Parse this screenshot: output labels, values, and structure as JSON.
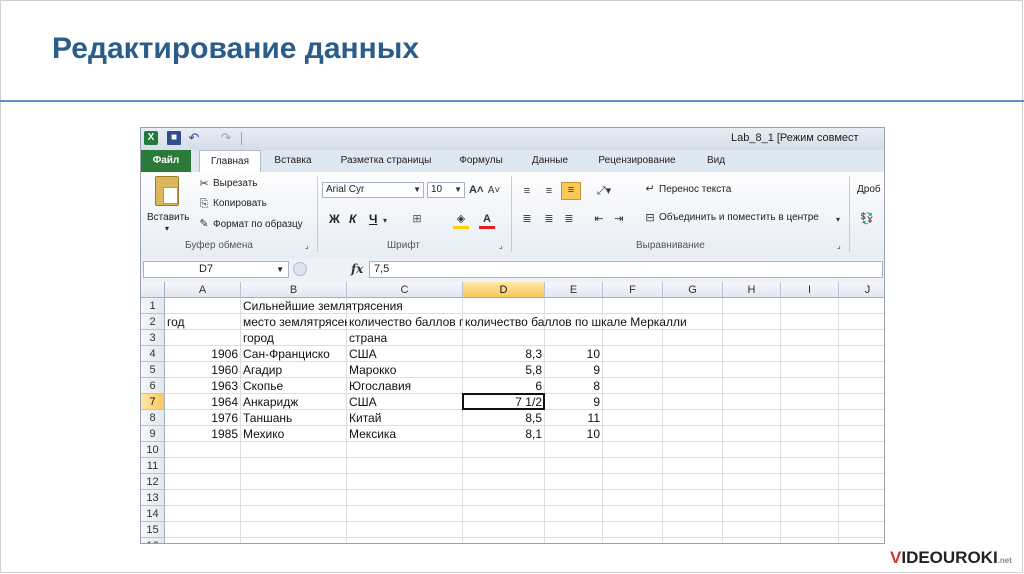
{
  "slide": {
    "title": "Редактирование данных",
    "logo_prefix": "V",
    "logo_main": "IDEOUROKI",
    "logo_suffix": ".net"
  },
  "window": {
    "title": "Lab_8_1  [Режим совмест"
  },
  "tabs": [
    "Файл",
    "Главная",
    "Вставка",
    "Разметка страницы",
    "Формулы",
    "Данные",
    "Рецензирование",
    "Вид"
  ],
  "ribbon": {
    "paste_label": "Вставить",
    "cut_label": "Вырезать",
    "copy_label": "Копировать",
    "format_painter_label": "Формат по образцу",
    "clipboard_group": "Буфер обмена",
    "font_name": "Arial Cyr",
    "font_size": "10",
    "bold": "Ж",
    "italic": "К",
    "underline": "Ч",
    "font_group": "Шрифт",
    "wrap_text_label": "Перенос текста",
    "merge_center_label": "Объединить и поместить в центре",
    "alignment_group": "Выравнивание",
    "number_format": "Дроб"
  },
  "formula_bar": {
    "cell_ref": "D7",
    "fx": "fx",
    "value": "7,5"
  },
  "sheet": {
    "columns": [
      "A",
      "B",
      "C",
      "D",
      "E",
      "F",
      "G",
      "H",
      "I",
      "J"
    ],
    "selected_column": "D",
    "rows": [
      "1",
      "2",
      "3",
      "4",
      "5",
      "6",
      "7",
      "8",
      "9",
      "10",
      "11",
      "12",
      "13",
      "14",
      "15",
      "16"
    ],
    "selected_row": "7",
    "cells": {
      "B1": "Сильнейшие землятрясения",
      "A2": "год",
      "B2": "место землятрясения",
      "C2": "количество баллов по шкале Рихтера",
      "D2": "количество баллов по шкале Меркалли",
      "B3": "город",
      "C3": "страна",
      "A4": "1906",
      "B4": "Сан-Франциско",
      "C4": "США",
      "D4": "8,3",
      "E4": "10",
      "A5": "1960",
      "B5": "Агадир",
      "C5": "Марокко",
      "D5": "5,8",
      "E5": "9",
      "A6": "1963",
      "B6": "Скопье",
      "C6": "Югославия",
      "D6": "6",
      "E6": "8",
      "A7": "1964",
      "B7": "Анкаридж",
      "C7": "США",
      "D7": "7 1/2",
      "E7": "9",
      "A8": "1976",
      "B8": "Таншань",
      "C8": "Китай",
      "D8": "8,5",
      "E8": "11",
      "A9": "1985",
      "B9": "Мехико",
      "C9": "Мексика",
      "D9": "8,1",
      "E9": "10"
    }
  }
}
